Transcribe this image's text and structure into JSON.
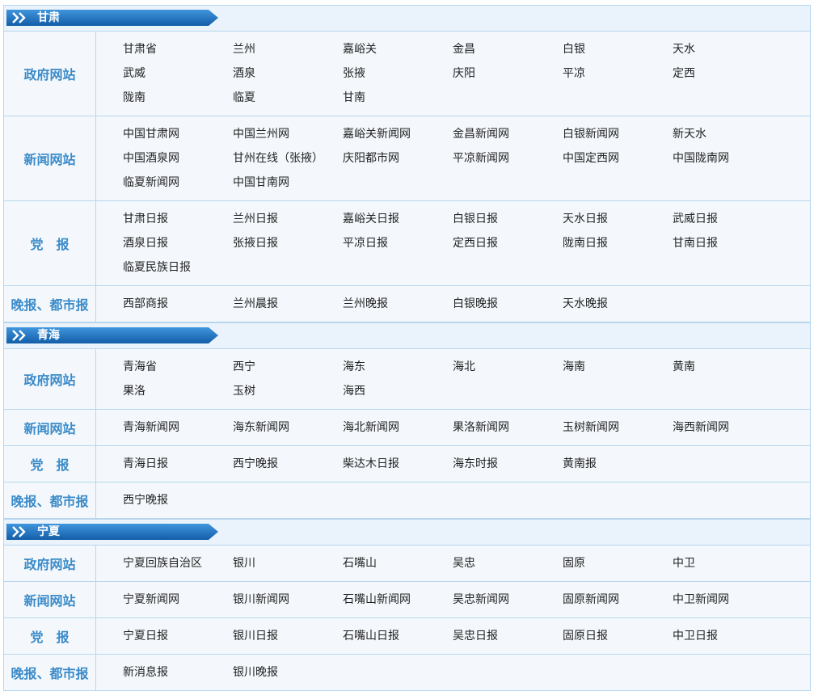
{
  "sections": [
    {
      "name": "甘肃",
      "rows": [
        {
          "category": "政府网站",
          "links": [
            "甘肃省",
            "兰州",
            "嘉峪关",
            "金昌",
            "白银",
            "天水",
            "武威",
            "酒泉",
            "张掖",
            "庆阳",
            "平凉",
            "定西",
            "陇南",
            "临夏",
            "甘南"
          ]
        },
        {
          "category": "新闻网站",
          "links": [
            "中国甘肃网",
            "中国兰州网",
            "嘉峪关新闻网",
            "金昌新闻网",
            "白银新闻网",
            "新天水",
            "中国酒泉网",
            "甘州在线（张掖）",
            "庆阳都市网",
            "平凉新闻网",
            "中国定西网",
            "中国陇南网",
            "临夏新闻网",
            "中国甘南网"
          ]
        },
        {
          "category": "党　报",
          "links": [
            "甘肃日报",
            "兰州日报",
            "嘉峪关日报",
            "白银日报",
            "天水日报",
            "武威日报",
            "酒泉日报",
            "张掖日报",
            "平凉日报",
            "定西日报",
            "陇南日报",
            "甘南日报",
            "临夏民族日报"
          ]
        },
        {
          "category": "晚报、都市报",
          "links": [
            "西部商报",
            "兰州晨报",
            "兰州晚报",
            "白银晚报",
            "天水晚报"
          ]
        }
      ]
    },
    {
      "name": "青海",
      "rows": [
        {
          "category": "政府网站",
          "links": [
            "青海省",
            "西宁",
            "海东",
            "海北",
            "海南",
            "黄南",
            "果洛",
            "玉树",
            "海西"
          ]
        },
        {
          "category": "新闻网站",
          "links": [
            "青海新闻网",
            "海东新闻网",
            "海北新闻网",
            "果洛新闻网",
            "玉树新闻网",
            "海西新闻网"
          ]
        },
        {
          "category": "党　报",
          "links": [
            "青海日报",
            "西宁晚报",
            "柴达木日报",
            "海东时报",
            "黄南报"
          ]
        },
        {
          "category": "晚报、都市报",
          "links": [
            "西宁晚报"
          ]
        }
      ]
    },
    {
      "name": "宁夏",
      "rows": [
        {
          "category": "政府网站",
          "links": [
            "宁夏回族自治区",
            "银川",
            "石嘴山",
            "吴忠",
            "固原",
            "中卫"
          ]
        },
        {
          "category": "新闻网站",
          "links": [
            "宁夏新闻网",
            "银川新闻网",
            "石嘴山新闻网",
            "吴忠新闻网",
            "固原新闻网",
            "中卫新闻网"
          ]
        },
        {
          "category": "党　报",
          "links": [
            "宁夏日报",
            "银川日报",
            "石嘴山日报",
            "吴忠日报",
            "固原日报",
            "中卫日报"
          ]
        },
        {
          "category": "晚报、都市报",
          "links": [
            "新消息报",
            "银川晚报"
          ]
        }
      ]
    }
  ],
  "colors": {
    "accent": "#3b8bc9",
    "border": "#b7d6ee",
    "tag": "#1f6fb8"
  },
  "icons": {
    "tag_chevron": "double-chevron-right-icon"
  }
}
